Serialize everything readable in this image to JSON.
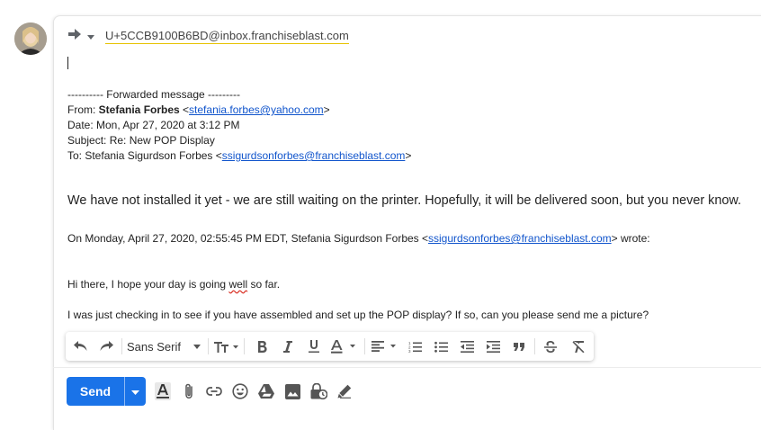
{
  "reply": {
    "recipient": "U+5CCB9100B6BD@inbox.franchiseblast.com"
  },
  "forwarded": {
    "header_line": "---------- Forwarded message ---------",
    "from_label": "From: ",
    "from_name": "Stefania Forbes",
    "from_email": "stefania.forbes@yahoo.com",
    "date_line": "Date: Mon, Apr 27, 2020 at 3:12 PM",
    "subject_line": "Subject: Re: New POP Display",
    "to_label": "To: Stefania Sigurdson Forbes ",
    "to_email": "ssigurdsonforbes@franchiseblast.com"
  },
  "body": {
    "main_text": "We have not installed it yet - we are still waiting on the printer. Hopefully, it will be delivered soon, but you never know.",
    "quote_header_prefix": "On Monday, April 27, 2020, 02:55:45 PM EDT, Stefania Sigurdson Forbes <",
    "quote_header_email": "ssigurdsonforbes@franchiseblast.com",
    "quote_header_suffix": "> wrote:",
    "quote_line1_a": "Hi there, I hope your day is going ",
    "quote_line1_b": "well",
    "quote_line1_c": " so far.",
    "quote_line2": "I was just checking in to see if you have assembled and set up the POP display? If so, can you please send me a picture?"
  },
  "toolbar": {
    "font": "Sans Serif"
  },
  "actions": {
    "send_label": "Send"
  },
  "colors": {
    "accent": "#1a73e8",
    "link": "#1155cc"
  }
}
